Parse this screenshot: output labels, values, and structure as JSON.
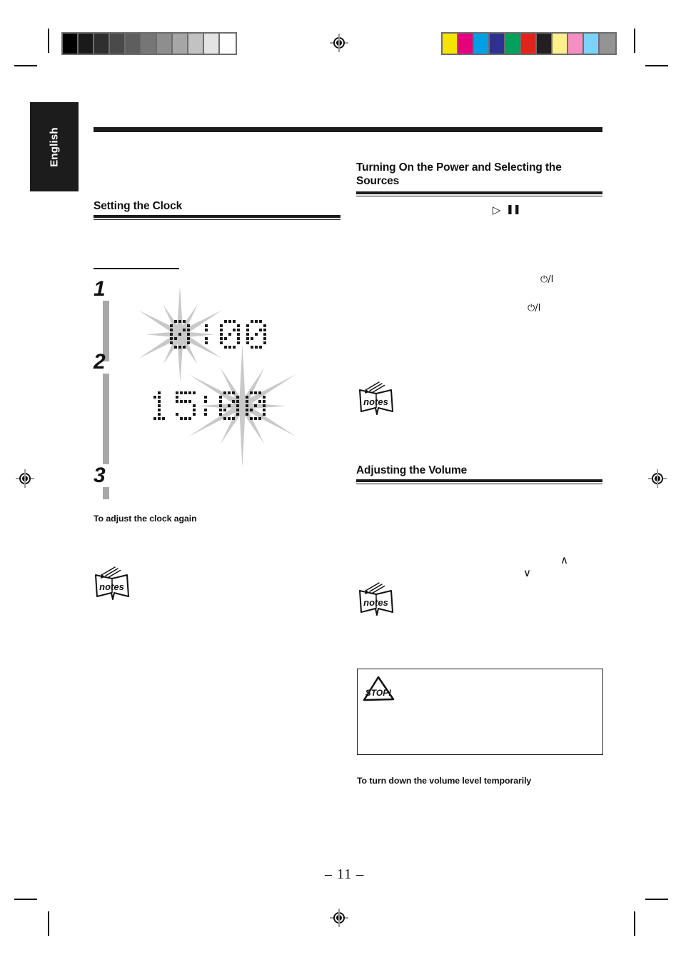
{
  "page": {
    "number_label": "– 11 –",
    "language_tab": "English"
  },
  "print_marks": {
    "grayscale_swatches": [
      "#000000",
      "#1a1a1a",
      "#2f2f2f",
      "#4a4a4a",
      "#5e5e5e",
      "#767676",
      "#8e8e8e",
      "#a6a6a6",
      "#c2c2c2",
      "#e4e4e4",
      "#ffffff"
    ],
    "color_swatches": [
      "#f4e400",
      "#e5007d",
      "#00a0e3",
      "#2e3192",
      "#00a15a",
      "#e2231a",
      "#231f20",
      "#fbf08a",
      "#f58fc2",
      "#7dd2f7",
      "#949494"
    ],
    "registration_icon": "registration-target-icon"
  },
  "left_column": {
    "heading": "Setting the Clock",
    "steps": [
      {
        "number": "1"
      },
      {
        "number": "2"
      },
      {
        "number": "3"
      }
    ],
    "displays": [
      {
        "name": "clock-display-hour",
        "hours": "0",
        "separator": ":",
        "minutes": "00",
        "flashing_part": "hours"
      },
      {
        "name": "clock-display-minute",
        "hours": "15",
        "separator": ":",
        "minutes": "00",
        "flashing_part": "minutes"
      }
    ],
    "subheading": "To adjust the clock again",
    "notes_icon_label": "notes"
  },
  "right_column": {
    "heading_power": "Turning On the Power and Selecting the Sources",
    "heading_volume": "Adjusting the Volume",
    "symbols": {
      "play": "▷",
      "pause": "❚❚",
      "power_standby_1": "⏻/I",
      "power_standby_2": "⏻/I",
      "volume_up": "∧",
      "volume_down": "∨"
    },
    "notes_icon_label": "notes",
    "caution_icon_label": "STOP!",
    "subheading": "To turn down the volume level temporarily"
  }
}
